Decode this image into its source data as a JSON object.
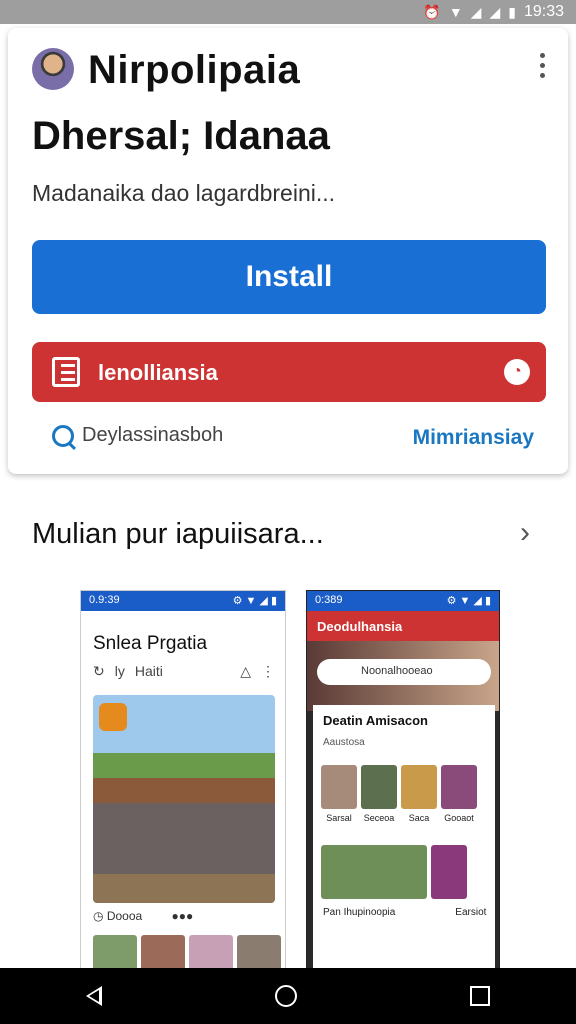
{
  "status": {
    "time": "19:33",
    "icons": [
      "alarm-icon",
      "wifi-icon",
      "signal-icon",
      "signal-icon",
      "battery-icon"
    ]
  },
  "app": {
    "name": "Nirpolipaia",
    "subtitle": "Dhersal; Idanaa",
    "description": "Madanaika dao lagardbreini...",
    "install_label": "Install",
    "secondary_label": "lenolliansia",
    "developer_label": "Deylassinasboh",
    "more_label": "Mimriansiay",
    "colors": {
      "install": "#1a6fd4",
      "secondary": "#cd3332",
      "link": "#1a78c2"
    }
  },
  "screenshots": {
    "title": "Mulian pur iapuiisara...",
    "shot1": {
      "status_time": "0.9:39",
      "title": "Snlea Prgatia",
      "toolbar": "ly",
      "toolbar2": "Haiti",
      "caption": "Doooa"
    },
    "shot2": {
      "status_time": "0:389",
      "header": "Deodulhansia",
      "search_text": "Noonalhooeao",
      "panel_title": "Deatin Amisacon",
      "panel_sub": "Aaustosa",
      "row1": [
        "Sarsal",
        "Seceoa",
        "Saca",
        "Gooaot"
      ],
      "row2_a": "Pan Ihupinoopia",
      "row2_b": "Earsiot"
    }
  }
}
